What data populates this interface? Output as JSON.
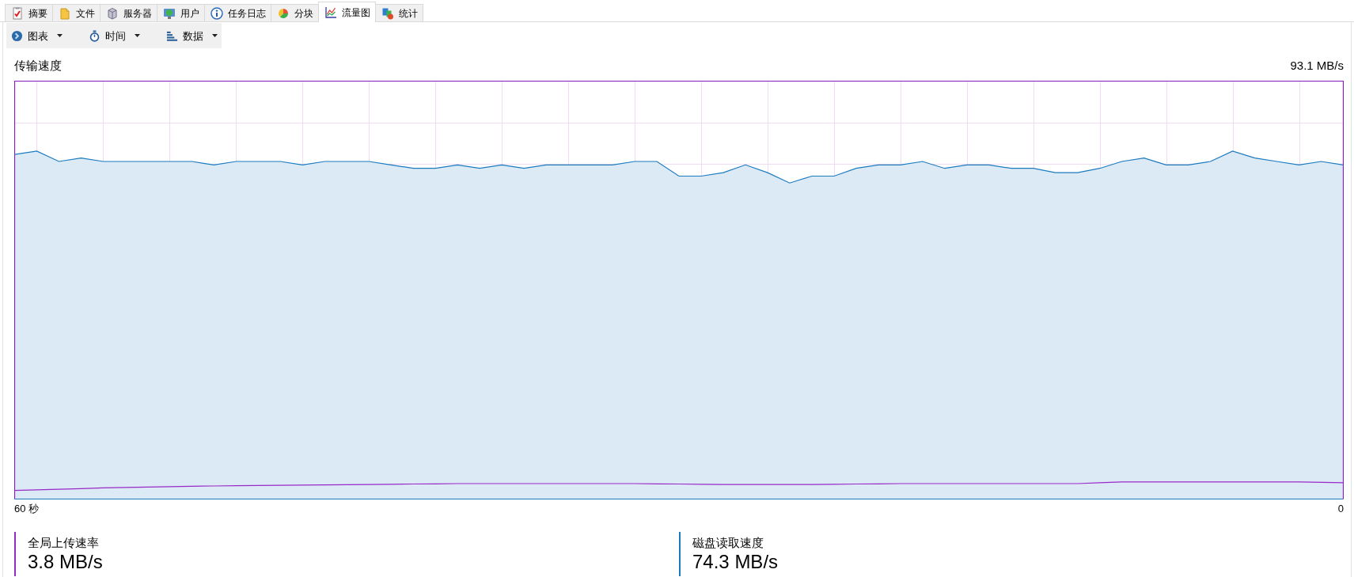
{
  "tabs": [
    {
      "label": "摘要",
      "selected": false
    },
    {
      "label": "文件",
      "selected": false
    },
    {
      "label": "服务器",
      "selected": false
    },
    {
      "label": "用户",
      "selected": false
    },
    {
      "label": "任务日志",
      "selected": false
    },
    {
      "label": "分块",
      "selected": false
    },
    {
      "label": "流量图",
      "selected": true
    },
    {
      "label": "统计",
      "selected": false
    }
  ],
  "toolbar": {
    "menus": [
      {
        "label": "图表"
      },
      {
        "label": "时间"
      },
      {
        "label": "数据"
      }
    ]
  },
  "chart": {
    "title": "传输速度",
    "scale_max": "93.1 MB/s",
    "x_start_label": "60 秒",
    "x_end_label": "0"
  },
  "legend": [
    {
      "label": "全局上传速率",
      "value": "3.8 MB/s",
      "color": "#9a2ac8"
    },
    {
      "label": "磁盘读取速度",
      "value": "74.3 MB/s",
      "color": "#1c7bbf"
    }
  ]
}
